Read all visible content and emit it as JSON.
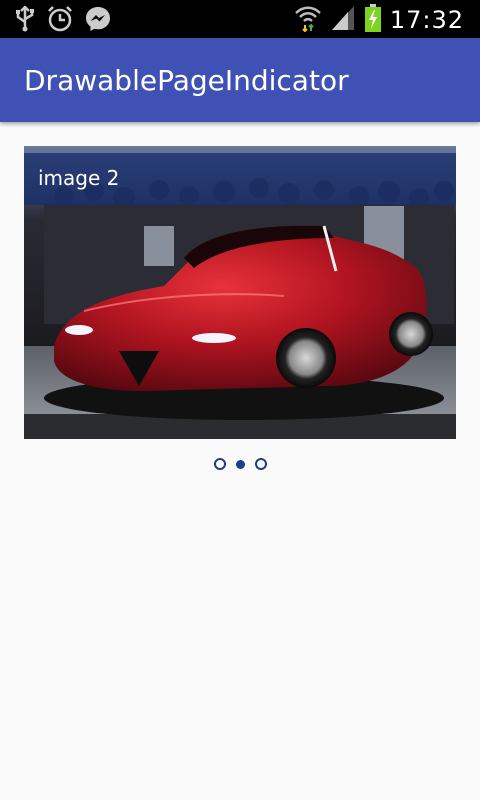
{
  "status_bar": {
    "time": "17:32",
    "left_icons": [
      "usb-icon",
      "alarm-clock-icon",
      "messenger-icon"
    ],
    "right_icons": [
      "wifi-icon",
      "signal-icon",
      "battery-charging-icon"
    ]
  },
  "app_bar": {
    "title": "DrawablePageIndicator",
    "color": "#3f51b5"
  },
  "pager": {
    "current_caption": "image 2",
    "image_subject": "red convertible sports car at an auto show",
    "pages_total": 3,
    "current_page_index": 1
  },
  "indicator": {
    "dots": [
      {
        "state": "inactive"
      },
      {
        "state": "active"
      },
      {
        "state": "inactive"
      }
    ],
    "color": "#1a3e8c"
  }
}
